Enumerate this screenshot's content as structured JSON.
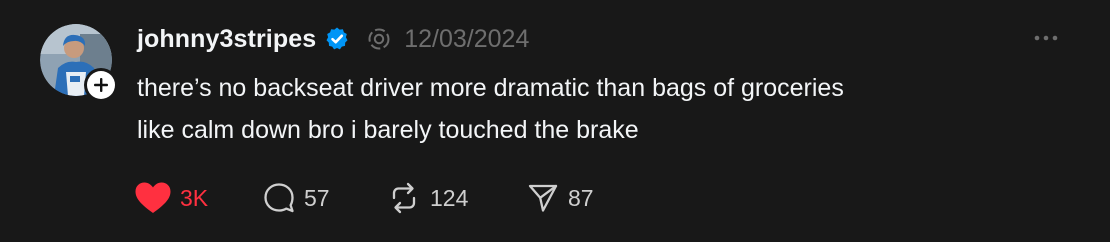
{
  "post": {
    "author": {
      "username": "johnny3stripes",
      "verified": true,
      "avatar_icon": "avatar-photo",
      "follow_icon": "plus-icon"
    },
    "timestamp": "12/03/2024",
    "text_lines": [
      "there’s no backseat driver more dramatic than bags of groceries",
      "like calm down bro i barely touched the brake"
    ],
    "actions": {
      "like": {
        "icon": "heart-icon",
        "count": "3K",
        "liked": true
      },
      "reply": {
        "icon": "comment-icon",
        "count": "57"
      },
      "repost": {
        "icon": "repost-icon",
        "count": "124"
      },
      "share": {
        "icon": "send-icon",
        "count": "87"
      }
    },
    "more_icon": "more-horizontal-icon"
  },
  "colors": {
    "background": "#181818",
    "text_primary": "#f3f5f7",
    "text_secondary": "#6e6e6e",
    "like": "#ff3040",
    "verified": "#0095f6"
  }
}
